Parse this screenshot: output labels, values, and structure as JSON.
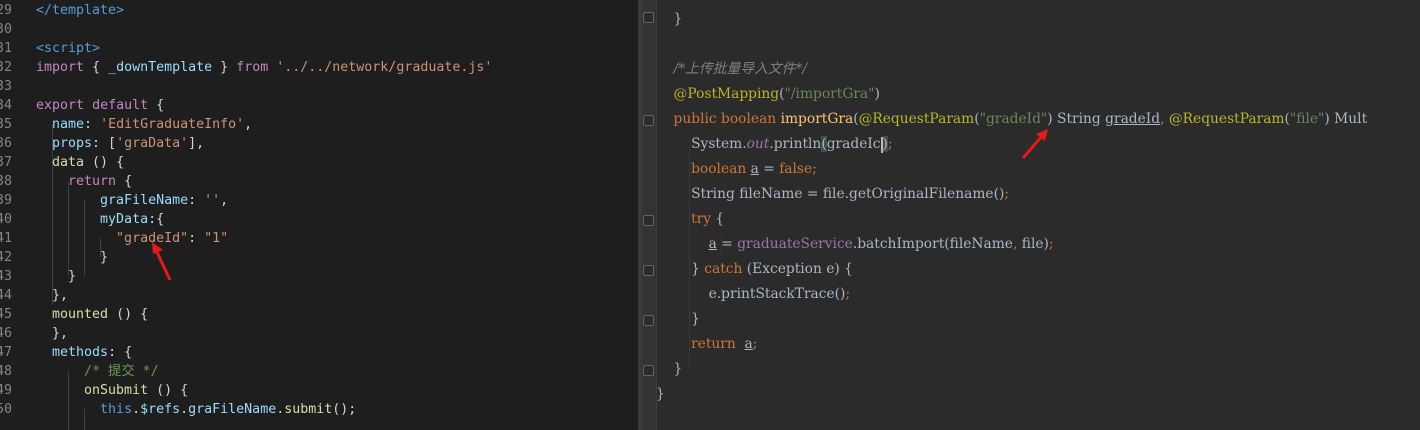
{
  "left_editor": {
    "lines": [
      {
        "n": "29",
        "tokens": [
          [
            "</template>",
            "t-tag"
          ]
        ]
      },
      {
        "n": "30",
        "tokens": []
      },
      {
        "n": "31",
        "tokens": [
          [
            "<script>",
            "t-tag"
          ]
        ]
      },
      {
        "n": "32",
        "tokens": [
          [
            "import",
            "t-kw"
          ],
          [
            " { ",
            "t-punc"
          ],
          [
            "_downTemplate",
            "t-prop"
          ],
          [
            " } ",
            "t-punc"
          ],
          [
            "from",
            "t-kw"
          ],
          [
            " ",
            "t-punc"
          ],
          [
            "'../../network/graduate.js'",
            "t-str"
          ]
        ]
      },
      {
        "n": "33",
        "tokens": []
      },
      {
        "n": "34",
        "tokens": [
          [
            "export",
            "t-kw"
          ],
          [
            " ",
            "t-punc"
          ],
          [
            "default",
            "t-kw"
          ],
          [
            " {",
            "t-punc"
          ]
        ]
      },
      {
        "n": "35",
        "tokens": [
          [
            "  name",
            "t-prop"
          ],
          [
            ": ",
            "t-punc"
          ],
          [
            "'EditGraduateInfo'",
            "t-str"
          ],
          [
            ",",
            "t-punc"
          ]
        ]
      },
      {
        "n": "36",
        "tokens": [
          [
            "  props",
            "t-prop"
          ],
          [
            ": [",
            "t-punc"
          ],
          [
            "'graData'",
            "t-str"
          ],
          [
            "],",
            "t-punc"
          ]
        ]
      },
      {
        "n": "37",
        "tokens": [
          [
            "  data",
            "t-fn"
          ],
          [
            " () {",
            "t-punc"
          ]
        ]
      },
      {
        "n": "38",
        "tokens": [
          [
            "    return",
            "t-kw"
          ],
          [
            " {",
            "t-punc"
          ]
        ]
      },
      {
        "n": "39",
        "tokens": [
          [
            "        graFileName",
            "t-prop"
          ],
          [
            ": ",
            "t-punc"
          ],
          [
            "''",
            "t-str"
          ],
          [
            ",",
            "t-punc"
          ]
        ]
      },
      {
        "n": "40",
        "tokens": [
          [
            "        myData",
            "t-prop"
          ],
          [
            ":{",
            "t-punc"
          ]
        ]
      },
      {
        "n": "41",
        "tokens": [
          [
            "          \"gradeId\"",
            "t-str"
          ],
          [
            ": ",
            "t-punc"
          ],
          [
            "\"1\"",
            "t-str"
          ]
        ]
      },
      {
        "n": "42",
        "tokens": [
          [
            "        }",
            "t-punc"
          ]
        ]
      },
      {
        "n": "43",
        "tokens": [
          [
            "    }",
            "t-punc"
          ]
        ]
      },
      {
        "n": "44",
        "tokens": [
          [
            "  },",
            "t-punc"
          ]
        ]
      },
      {
        "n": "45",
        "tokens": [
          [
            "  mounted",
            "t-fn"
          ],
          [
            " () {",
            "t-punc"
          ]
        ]
      },
      {
        "n": "46",
        "tokens": [
          [
            "  },",
            "t-punc"
          ]
        ]
      },
      {
        "n": "47",
        "tokens": [
          [
            "  methods",
            "t-prop"
          ],
          [
            ": {",
            "t-punc"
          ]
        ]
      },
      {
        "n": "48",
        "tokens": [
          [
            "      /* 提交 */",
            "t-com"
          ]
        ]
      },
      {
        "n": "49",
        "tokens": [
          [
            "      onSubmit",
            "t-fn"
          ],
          [
            " () {",
            "t-punc"
          ]
        ]
      },
      {
        "n": "50",
        "tokens": [
          [
            "        ",
            "t-punc"
          ],
          [
            "this",
            "t-kw2"
          ],
          [
            ".",
            "t-punc"
          ],
          [
            "$refs",
            "t-prop"
          ],
          [
            ".",
            "t-punc"
          ],
          [
            "graFileName",
            "t-prop"
          ],
          [
            ".",
            "t-punc"
          ],
          [
            "submit",
            "t-fn"
          ],
          [
            "();",
            "t-punc"
          ]
        ]
      }
    ]
  },
  "right_editor": {
    "lines": [
      {
        "tokens": [
          [
            "    }",
            "p"
          ]
        ]
      },
      {
        "tokens": []
      },
      {
        "tokens": [
          [
            "    /*上传批量导入文件*/",
            "j-com"
          ]
        ]
      },
      {
        "tokens": [
          [
            "    @PostMapping",
            "j-ann"
          ],
          [
            "(",
            "p"
          ],
          [
            "\"/importGra\"",
            "j-str"
          ],
          [
            ")",
            "p"
          ]
        ]
      },
      {
        "tokens": [
          [
            "    public ",
            "j-kw"
          ],
          [
            "boolean ",
            "j-kw"
          ],
          [
            "importGra",
            "j-fn"
          ],
          [
            "(",
            "p"
          ],
          [
            "@RequestParam",
            "j-ann"
          ],
          [
            "(",
            "p"
          ],
          [
            "\"gradeId\"",
            "j-str"
          ],
          [
            ") String ",
            "p"
          ],
          [
            "gradeId",
            "j-var"
          ],
          [
            ", ",
            "j-kw"
          ],
          [
            "@RequestParam",
            "j-ann"
          ],
          [
            "(",
            "p"
          ],
          [
            "\"file\"",
            "j-str"
          ],
          [
            ") Mult",
            "p"
          ]
        ]
      },
      {
        "tokens": [
          [
            "        System.",
            "p"
          ],
          [
            "out",
            "j-field"
          ],
          [
            ".println",
            "p"
          ],
          [
            "(",
            "hl"
          ],
          [
            "gradeIc",
            "p"
          ],
          [
            "|",
            "caret"
          ],
          [
            ")",
            "hl"
          ],
          [
            ";",
            "j-kw"
          ]
        ]
      },
      {
        "tokens": [
          [
            "        boolean ",
            "j-kw"
          ],
          [
            "a",
            "j-var"
          ],
          [
            " = ",
            "p"
          ],
          [
            "false",
            "j-kw"
          ],
          [
            ";",
            "j-kw"
          ]
        ]
      },
      {
        "tokens": [
          [
            "        String fileName = file.getOriginalFilename()",
            "p"
          ],
          [
            ";",
            "j-kw"
          ]
        ]
      },
      {
        "tokens": [
          [
            "        try ",
            "j-kw"
          ],
          [
            "{",
            "p"
          ]
        ]
      },
      {
        "tokens": [
          [
            "            ",
            "p"
          ],
          [
            "a",
            "j-var"
          ],
          [
            " = ",
            "p"
          ],
          [
            "graduateService",
            "j-svc"
          ],
          [
            ".batchImport(fileName",
            "p"
          ],
          [
            ", ",
            "j-kw"
          ],
          [
            "file)",
            "p"
          ],
          [
            ";",
            "j-kw"
          ]
        ]
      },
      {
        "tokens": [
          [
            "        } ",
            "p"
          ],
          [
            "catch ",
            "j-kw"
          ],
          [
            "(Exception e) {",
            "p"
          ]
        ]
      },
      {
        "tokens": [
          [
            "            e.printStackTrace()",
            "p"
          ],
          [
            ";",
            "j-kw"
          ]
        ]
      },
      {
        "tokens": [
          [
            "        }",
            "p"
          ]
        ]
      },
      {
        "tokens": [
          [
            "        return  ",
            "j-kw"
          ],
          [
            "a",
            "j-var"
          ],
          [
            ";",
            "j-kw"
          ]
        ]
      },
      {
        "tokens": [
          [
            "    }",
            "p"
          ]
        ]
      },
      {
        "tokens": [
          [
            "}",
            "p"
          ]
        ]
      }
    ]
  },
  "colors": {
    "arrow": "#e21b1b",
    "left_bg": "#1e1e1e",
    "right_bg": "#2b2b2b"
  }
}
